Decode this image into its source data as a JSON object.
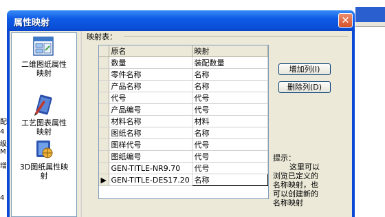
{
  "background_left_glyphs": [
    "配",
    "4",
    "级M",
    "增",
    "4"
  ],
  "dialog": {
    "title": "属性映射",
    "close_glyph": "✕"
  },
  "sidebar": {
    "items": [
      {
        "label_line1": "二维图纸属性",
        "label_line2": "映射",
        "icon": "2d-drawing-icon"
      },
      {
        "label_line1": "工艺图表属性",
        "label_line2": "映射",
        "icon": "process-chart-icon"
      },
      {
        "label_line1": "3D图纸属性映",
        "label_line2": "射",
        "icon": "3d-drawing-icon"
      }
    ]
  },
  "mapping": {
    "group_label": "映射表：",
    "columns": [
      "原名",
      "映射"
    ],
    "rows": [
      [
        "数量",
        "装配数量"
      ],
      [
        "零件名称",
        "名称"
      ],
      [
        "产品名称",
        "名称"
      ],
      [
        "代号",
        "代号"
      ],
      [
        "产品编号",
        "代号"
      ],
      [
        "材料名称",
        "材料"
      ],
      [
        "图纸名称",
        "名称"
      ],
      [
        "图样代号",
        "代号"
      ],
      [
        "图纸编号",
        "代号"
      ],
      [
        "GEN-TITLE-NR9.70",
        "代号"
      ],
      [
        "GEN-TITLE-DES17.20",
        "名称"
      ]
    ],
    "current_row_marker": "▶"
  },
  "buttons": {
    "add_column": "增加列(I)",
    "delete_column": "删除列(D)"
  },
  "hint": {
    "title": "提示：",
    "line1": "这里可以",
    "line2": "浏览已定义的",
    "line3": "名称映射，也",
    "line4": "可以创建新的",
    "line5": "名称映射"
  }
}
